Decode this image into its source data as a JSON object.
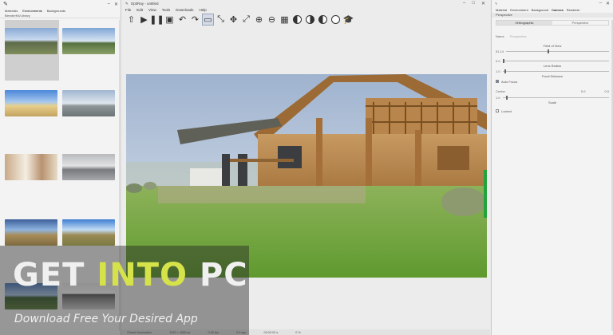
{
  "left_panel": {
    "tabs": [
      "Materials",
      "Environments",
      "Backgrounds"
    ],
    "active_tab": "Environments",
    "sub_label": "BlenderKit/Library",
    "thumbnails": [
      {
        "caption": "",
        "style": "sky1",
        "selected": true
      },
      {
        "caption": "",
        "style": "sky2"
      },
      {
        "caption": "",
        "style": "beach"
      },
      {
        "caption": "",
        "style": "clouds"
      },
      {
        "caption": "",
        "style": "room1"
      },
      {
        "caption": "",
        "style": "room2"
      },
      {
        "caption": "",
        "style": "sunset"
      },
      {
        "caption": "",
        "style": "sunny"
      },
      {
        "caption": "",
        "style": "park"
      },
      {
        "caption": "",
        "style": "hall"
      }
    ]
  },
  "center": {
    "title": "OptiRay - untitled",
    "menu": [
      "File",
      "Edit",
      "View",
      "Tools",
      "Downloads",
      "Help"
    ],
    "toolbar_icons": [
      "arrow-up-icon",
      "play-icon",
      "pause-icon",
      "save-icon",
      "undo-icon",
      "redo-icon",
      "select-rect-icon",
      "scale-icon",
      "move-icon",
      "resize-icon",
      "zoom-in-icon",
      "zoom-out-icon",
      "grid-icon",
      "shade-left-icon",
      "shade-mid-icon",
      "shade-right-icon",
      "circle-icon",
      "grad-cap-icon"
    ],
    "status": [
      "Global Illumination",
      "1920 × 1080 px",
      "0.00 fps",
      "0.0 spp",
      "00:00:00 s",
      "0 %"
    ]
  },
  "right_panel": {
    "tabs": [
      "Material",
      "Environment",
      "Background",
      "Camera",
      "Renderer"
    ],
    "active_tab": "Camera",
    "subtab": "Perspective",
    "segments": [
      "Orthographic",
      "Perspective"
    ],
    "name_label": "Name",
    "name_placeholder": "Perspective",
    "fov_label": "Field of View",
    "fov_value": "51.14",
    "lens_label": "Lens Radius",
    "lens_value": "0.0",
    "focal_label": "Focal Distance",
    "focal_value": "1.0",
    "autofocus_label": "Auto Focus",
    "center_label": "Center",
    "center_x": "0.0",
    "center_y": "0.0",
    "scale_label": "Scale",
    "scale_value": "1.0",
    "locked_label": "Locked"
  },
  "watermark": {
    "brand_a": "GET ",
    "brand_b": "INTO",
    "brand_c": " PC",
    "tagline": "Download Free Your Desired App"
  }
}
